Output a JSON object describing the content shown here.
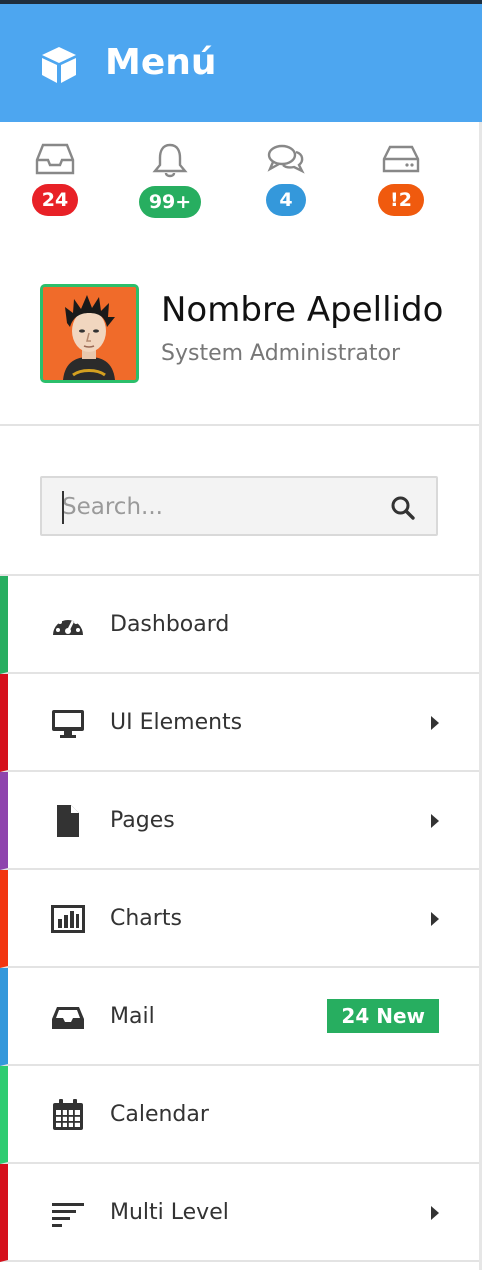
{
  "header": {
    "title": "Menú",
    "logo_icon": "cube-icon",
    "color": "#4da6f0"
  },
  "notifications": [
    {
      "icon": "inbox-icon",
      "count": "24",
      "color": "#e82127"
    },
    {
      "icon": "bell-icon",
      "count": "99+",
      "color": "#27ae60"
    },
    {
      "icon": "comments-icon",
      "count": "4",
      "color": "#3498db"
    },
    {
      "icon": "server-icon",
      "count": "!2",
      "color": "#f05a0e"
    }
  ],
  "profile": {
    "name": "Nombre Apellido",
    "role": "System Administrator"
  },
  "search": {
    "placeholder": "Search...",
    "value": ""
  },
  "menu": [
    {
      "label": "Dashboard",
      "icon": "dashboard-icon",
      "accent": "#27ae60",
      "submenu": false
    },
    {
      "label": "UI Elements",
      "icon": "desktop-icon",
      "accent": "#d5101c",
      "submenu": true
    },
    {
      "label": "Pages",
      "icon": "file-icon",
      "accent": "#8e44ad",
      "submenu": true
    },
    {
      "label": "Charts",
      "icon": "bar-chart-icon",
      "accent": "#f2350f",
      "submenu": true
    },
    {
      "label": "Mail",
      "icon": "inbox-icon",
      "accent": "#3498db",
      "submenu": false,
      "badge": "24 New"
    },
    {
      "label": "Calendar",
      "icon": "calendar-icon",
      "accent": "#2ecc71",
      "submenu": false
    },
    {
      "label": "Multi Level",
      "icon": "align-left-icon",
      "accent": "#d5101c",
      "submenu": true
    }
  ]
}
